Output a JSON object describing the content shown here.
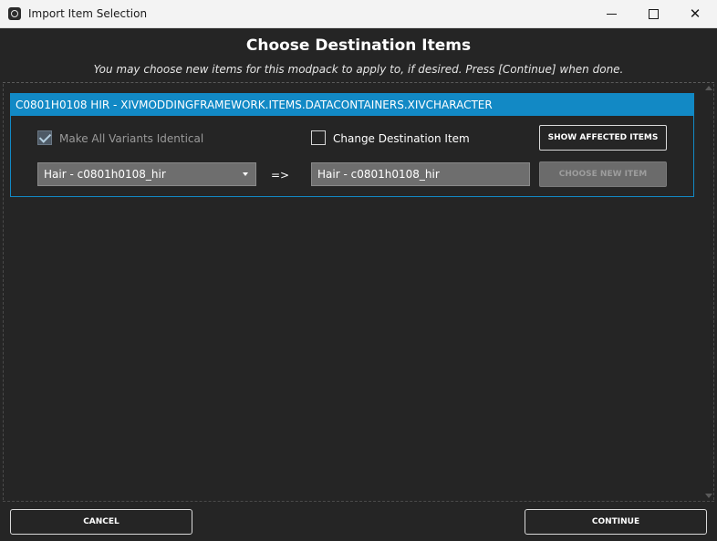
{
  "window": {
    "title": "Import Item Selection",
    "minimize_icon": "minimize-icon",
    "maximize_icon": "maximize-icon",
    "close_icon": "close-icon",
    "close_glyph": "✕"
  },
  "header": {
    "title": "Choose Destination Items",
    "subtitle": "You may choose new items for this modpack to apply to, if desired. Press [Continue] when done."
  },
  "item": {
    "header": "C0801H0108 HIR - XIVMODDINGFRAMEWORK.ITEMS.DATACONTAINERS.XIVCHARACTER",
    "make_all_variants_label": "Make All Variants Identical",
    "make_all_variants_checked": true,
    "make_all_variants_enabled": false,
    "change_destination_label": "Change Destination Item",
    "change_destination_checked": false,
    "show_affected_label": "SHOW AFFECTED ITEMS",
    "source_select_value": "Hair - c0801h0108_hir",
    "arrow": "=>",
    "destination_value": "Hair - c0801h0108_hir",
    "choose_new_label": "CHOOSE NEW ITEM",
    "choose_new_enabled": false
  },
  "footer": {
    "cancel_label": "CANCEL",
    "continue_label": "CONTINUE"
  },
  "colors": {
    "background": "#252525",
    "accent": "#1289c5",
    "titlebar": "#f3f3f3",
    "field": "#6e6e6e"
  }
}
